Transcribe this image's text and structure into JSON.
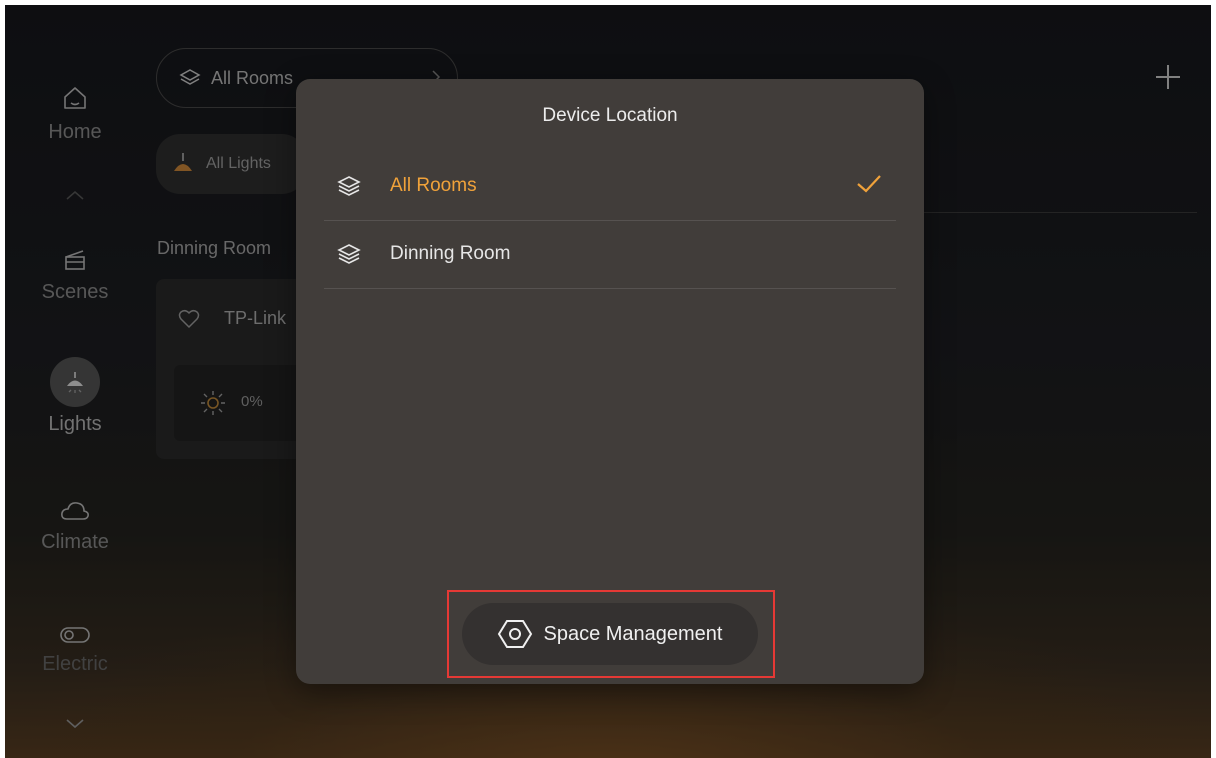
{
  "sidebar": {
    "items": [
      {
        "label": "Home",
        "icon": "home-icon"
      },
      {
        "label": "Scenes",
        "icon": "clapperboard-icon"
      },
      {
        "label": "Lights",
        "icon": "lamp-icon",
        "active": true
      },
      {
        "label": "Climate",
        "icon": "cloud-icon"
      },
      {
        "label": "Electric",
        "icon": "switch-icon"
      }
    ]
  },
  "header": {
    "room_selector_label": "All Rooms",
    "filter_chip_label": "All Lights",
    "add_icon": "plus-icon"
  },
  "main": {
    "section_title": "Dinning Room",
    "device_card": {
      "name": "TP-Link",
      "brightness": "0%"
    }
  },
  "modal": {
    "title": "Device Location",
    "rooms": [
      {
        "label": "All Rooms",
        "selected": true
      },
      {
        "label": "Dinning Room",
        "selected": false
      }
    ],
    "space_button_label": "Space Management"
  },
  "colors": {
    "accent": "#f0a23a",
    "highlight_border": "#e53935",
    "modal_bg": "#413d3a"
  }
}
